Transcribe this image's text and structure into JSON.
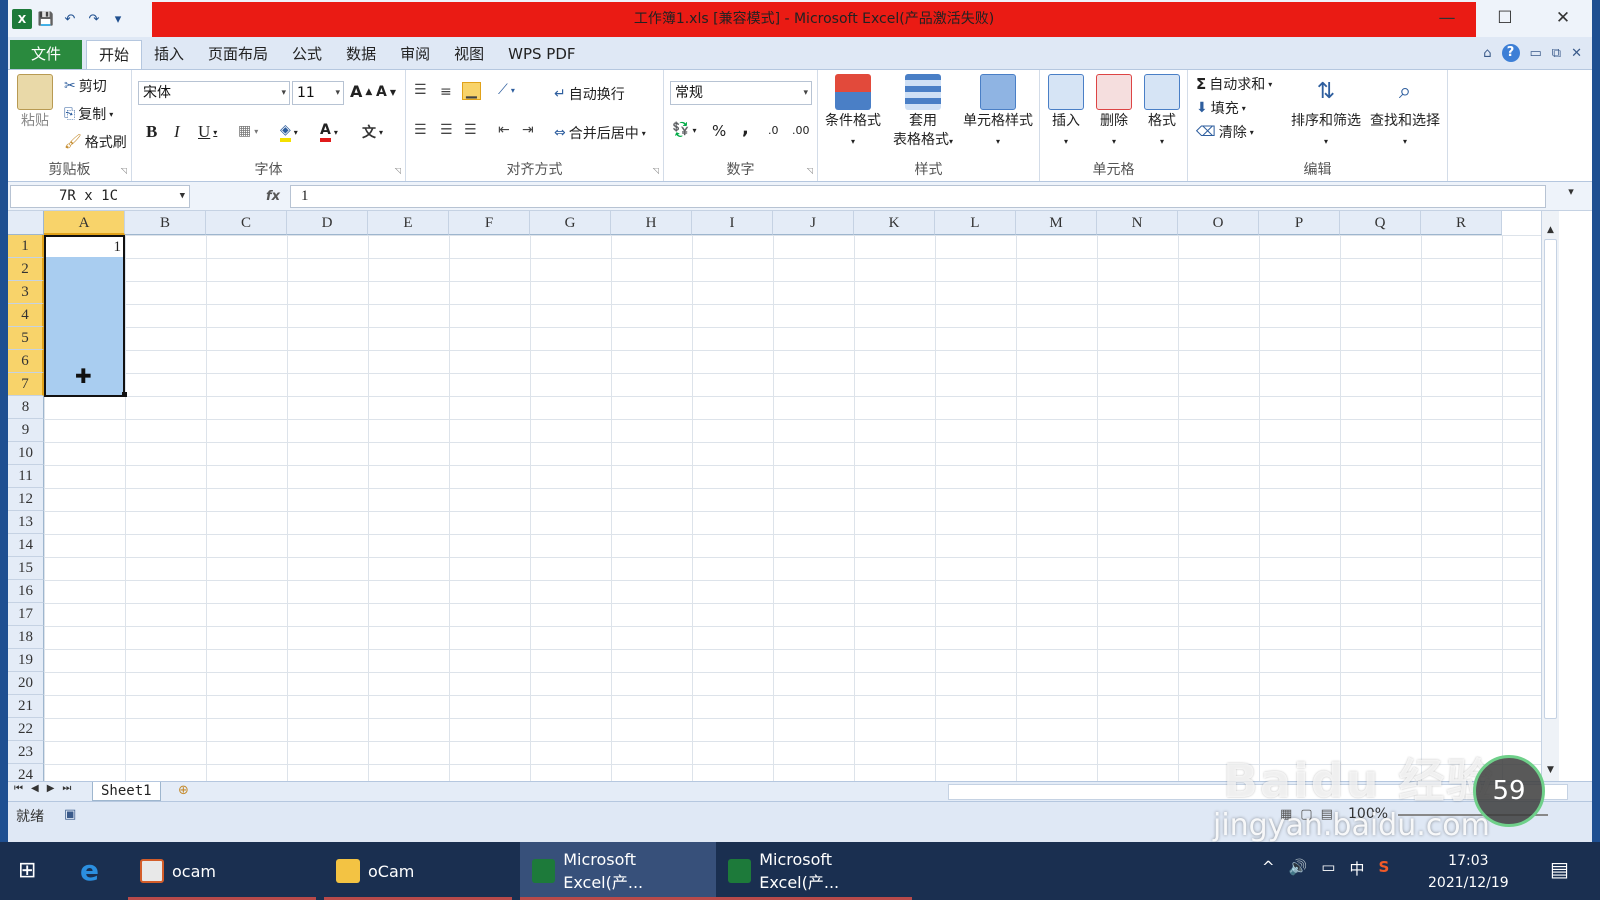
{
  "window": {
    "title": "工作簿1.xls  [兼容模式] - Microsoft Excel(产品激活失败)",
    "controls": {
      "minimize": "—",
      "maximize": "☐",
      "close": "✕"
    }
  },
  "quick_access": {
    "app_icon": "X",
    "save": "💾",
    "undo": "↶",
    "redo": "↷",
    "more": "▾"
  },
  "tabs": [
    "文件",
    "开始",
    "插入",
    "页面布局",
    "公式",
    "数据",
    "审阅",
    "视图",
    "WPS PDF"
  ],
  "active_tab": "开始",
  "ribbon": {
    "clipboard": {
      "label": "剪贴板",
      "paste": "粘贴",
      "cut": "剪切",
      "copy": "复制",
      "format_painter": "格式刷"
    },
    "font": {
      "label": "字体",
      "font_name": "宋体",
      "font_size": "11",
      "grow": "A",
      "shrink": "A",
      "bold": "B",
      "italic": "I",
      "underline": "U",
      "border": "▦",
      "fill": "◈",
      "color": "A",
      "phonetic": "文"
    },
    "alignment": {
      "label": "对齐方式",
      "wrap": "自动换行",
      "merge": "合并后居中"
    },
    "number": {
      "label": "数字",
      "format": "常规",
      "currency": "💱",
      "percent": "%",
      "comma": ",",
      "inc_dec": ".0",
      "dec_dec": ".00"
    },
    "styles": {
      "label": "样式",
      "conditional": "条件格式",
      "table_style_line1": "套用",
      "table_style_line2": "表格格式",
      "cell_style": "单元格样式"
    },
    "cells": {
      "label": "单元格",
      "insert": "插入",
      "delete": "删除",
      "format": "格式"
    },
    "editing": {
      "label": "编辑",
      "autosum": "自动求和",
      "fill": "填充",
      "clear": "清除",
      "sort_filter": "排序和筛选",
      "find_select": "查找和选择"
    }
  },
  "formula_bar": {
    "name_box": "7R x 1C",
    "fx": "fx",
    "value": "1"
  },
  "columns": [
    "A",
    "B",
    "C",
    "D",
    "E",
    "F",
    "G",
    "H",
    "I",
    "J",
    "K",
    "L",
    "M",
    "N",
    "O",
    "P",
    "Q",
    "R"
  ],
  "rows": [
    "1",
    "2",
    "3",
    "4",
    "5",
    "6",
    "7",
    "8",
    "9",
    "10",
    "11",
    "12",
    "13",
    "14",
    "15",
    "16",
    "17",
    "18",
    "19",
    "20",
    "21",
    "22",
    "23",
    "24"
  ],
  "cells": {
    "A1": "1"
  },
  "selection": {
    "range": "A1:A7"
  },
  "sheet_tabs": [
    "Sheet1"
  ],
  "status": {
    "ready": "就绪",
    "zoom": "100%"
  },
  "watermark": {
    "line1": "Baidu 经验",
    "line2": "jingyan.baidu.com",
    "badge": "59"
  },
  "taskbar": {
    "items": [
      {
        "label": "ocam"
      },
      {
        "label": "oCam"
      },
      {
        "label": "Microsoft Excel(产..."
      },
      {
        "label": "Microsoft Excel(产..."
      }
    ],
    "tray": {
      "ime": "中",
      "sogou": "S"
    },
    "time": "17:03",
    "date": "2021/12/19"
  },
  "colors": {
    "title_bg": "#ea1b14",
    "file_tab": "#2a8a3e",
    "selection": "#a9cdf0",
    "header_selected": "#f8d36a",
    "taskbar": "#1a2f50"
  }
}
